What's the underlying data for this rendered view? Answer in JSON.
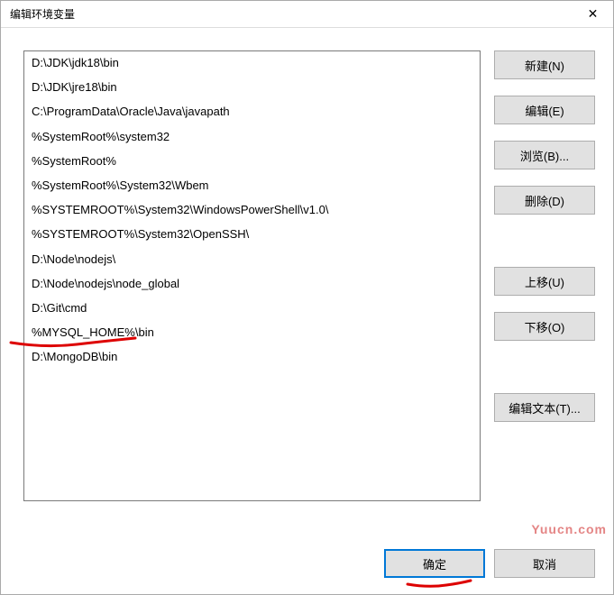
{
  "titlebar": {
    "title": "编辑环境变量",
    "close_icon": "✕"
  },
  "list": {
    "items": [
      "D:\\JDK\\jdk18\\bin",
      "D:\\JDK\\jre18\\bin",
      "C:\\ProgramData\\Oracle\\Java\\javapath",
      "%SystemRoot%\\system32",
      "%SystemRoot%",
      "%SystemRoot%\\System32\\Wbem",
      "%SYSTEMROOT%\\System32\\WindowsPowerShell\\v1.0\\",
      "%SYSTEMROOT%\\System32\\OpenSSH\\",
      "D:\\Node\\nodejs\\",
      "D:\\Node\\nodejs\\node_global",
      "D:\\Git\\cmd",
      "%MYSQL_HOME%\\bin",
      "D:\\MongoDB\\bin"
    ]
  },
  "buttons": {
    "new": "新建(N)",
    "edit": "编辑(E)",
    "browse": "浏览(B)...",
    "delete": "删除(D)",
    "moveup": "上移(U)",
    "movedown": "下移(O)",
    "edittext": "编辑文本(T)...",
    "ok": "确定",
    "cancel": "取消"
  },
  "watermark": "Yuucn.com"
}
